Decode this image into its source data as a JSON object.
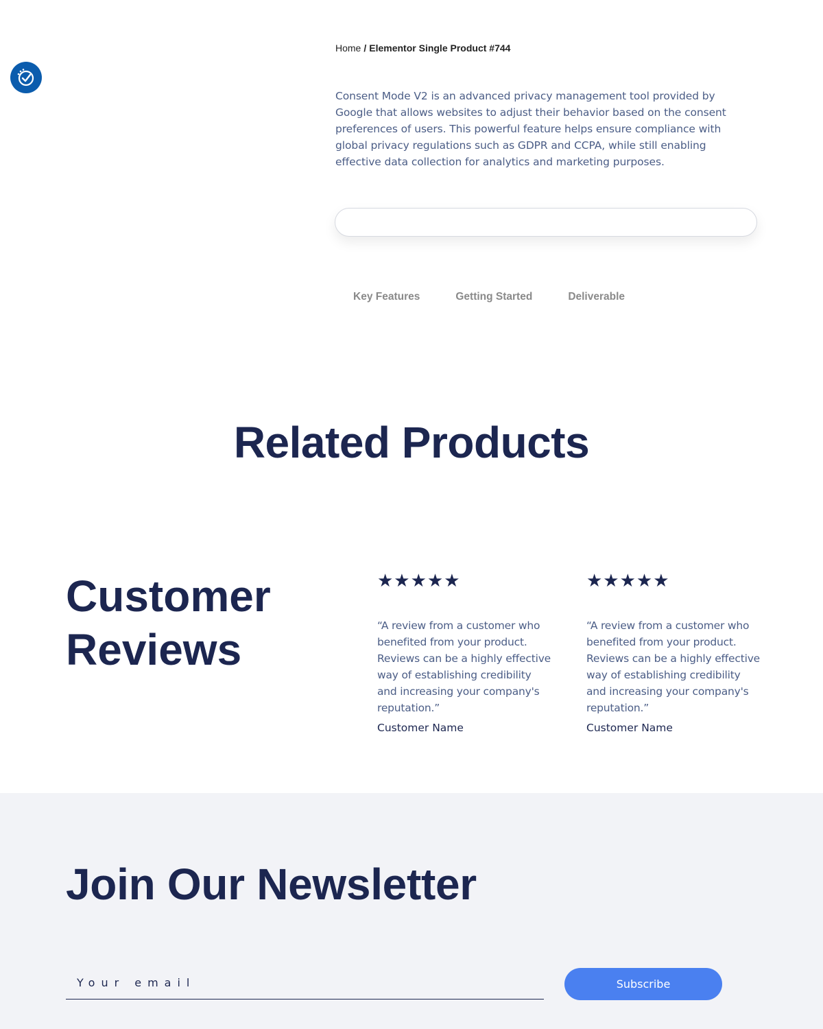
{
  "consent_badge": {
    "icon": "check-shield-icon"
  },
  "breadcrumb": {
    "home": "Home",
    "separator": "/",
    "current": "Elementor Single Product #744"
  },
  "product": {
    "description": "Consent Mode V2 is an advanced privacy management tool provided by Google that allows websites to adjust their behavior based on the consent preferences of users. This powerful feature helps ensure compliance with global privacy regulations such as GDPR and CCPA, while still enabling effective data collection for analytics and marketing purposes.",
    "tabs": [
      {
        "label": "Key Features"
      },
      {
        "label": "Getting Started"
      },
      {
        "label": "Deliverable"
      }
    ]
  },
  "related": {
    "title": "Related Products"
  },
  "reviews": {
    "title_line1": "Customer",
    "title_line2": "Reviews",
    "items": [
      {
        "stars": "★★★★★",
        "rating": 5,
        "text": "“A review from a customer who benefited from your product. Reviews can be a highly effective way of establishing credibility and increasing your company's reputation.”",
        "name": "Customer Name"
      },
      {
        "stars": "★★★★★",
        "rating": 5,
        "text": "“A review from a customer who benefited from your product. Reviews can be a highly effective way of establishing credibility and increasing your company's reputation.”",
        "name": "Customer Name"
      }
    ]
  },
  "newsletter": {
    "title": "Join Our Newsletter",
    "email_placeholder": "Your email",
    "subscribe_label": "Subscribe"
  },
  "colors": {
    "navy": "#1c2650",
    "body_text": "#4b5d86",
    "badge_blue": "#0b5cad",
    "button_blue": "#4a80f0",
    "newsletter_bg": "#f2f3f7"
  }
}
